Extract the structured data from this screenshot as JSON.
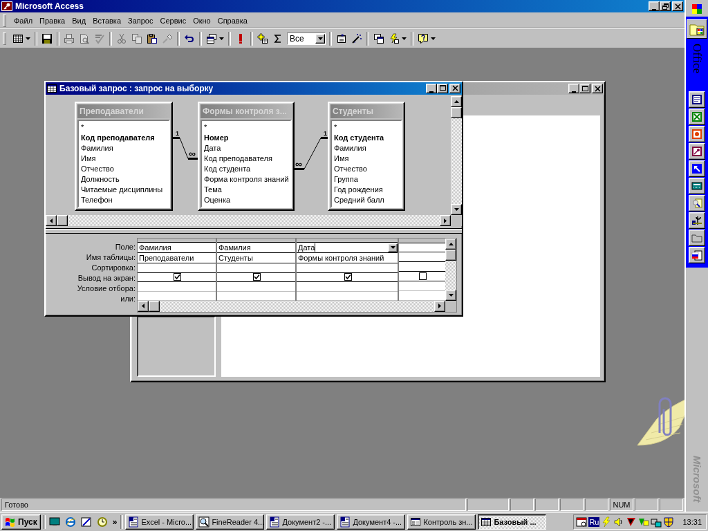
{
  "app": {
    "title": "Microsoft Access"
  },
  "menu": [
    "Файл",
    "Правка",
    "Вид",
    "Вставка",
    "Запрос",
    "Сервис",
    "Окно",
    "Справка"
  ],
  "toolbar": {
    "buttons": [
      {
        "disabled": false
      },
      {
        "disabled": false
      },
      {
        "disabled": true
      },
      {
        "disabled": true
      },
      {
        "disabled": true
      },
      {
        "disabled": true
      },
      {
        "disabled": true
      },
      {
        "disabled": false
      },
      {
        "disabled": true
      },
      {
        "disabled": false
      },
      {
        "disabled": false
      },
      {
        "disabled": false
      },
      {
        "disabled": false
      },
      {
        "disabled": false
      },
      {
        "disabled": false
      },
      {
        "disabled": false
      },
      {
        "disabled": false
      },
      {
        "disabled": false
      },
      {
        "disabled": false
      }
    ],
    "filter_combo": {
      "value": "Все"
    }
  },
  "query_window": {
    "title": "Базовый запрос : запрос на выборку",
    "tables": [
      {
        "title": "Преподаватели",
        "fields": [
          {
            "name": "*",
            "key": false
          },
          {
            "name": "Код преподавателя",
            "key": true
          },
          {
            "name": "Фамилия",
            "key": false
          },
          {
            "name": "Имя",
            "key": false
          },
          {
            "name": "Отчество",
            "key": false
          },
          {
            "name": "Должность",
            "key": false
          },
          {
            "name": "Читаемые дисциплины",
            "key": false
          },
          {
            "name": "Телефон",
            "key": false
          }
        ]
      },
      {
        "title": "Формы контроля з...",
        "fields": [
          {
            "name": "*",
            "key": false
          },
          {
            "name": "Номер",
            "key": true
          },
          {
            "name": "Дата",
            "key": false
          },
          {
            "name": "Код преподавателя",
            "key": false
          },
          {
            "name": "Код студента",
            "key": false
          },
          {
            "name": "Форма контроля знаний",
            "key": false
          },
          {
            "name": "Тема",
            "key": false
          },
          {
            "name": "Оценка",
            "key": false
          }
        ]
      },
      {
        "title": "Студенты",
        "fields": [
          {
            "name": "*",
            "key": false
          },
          {
            "name": "Код студента",
            "key": true
          },
          {
            "name": "Фамилия",
            "key": false
          },
          {
            "name": "Имя",
            "key": false
          },
          {
            "name": "Отчество",
            "key": false
          },
          {
            "name": "Группа",
            "key": false
          },
          {
            "name": "Год рождения",
            "key": false
          },
          {
            "name": "Средний балл",
            "key": false
          }
        ]
      }
    ],
    "relationships": [
      {
        "one_label": "1",
        "many_label": "∞"
      },
      {
        "one_label": "1",
        "many_label": "∞"
      }
    ],
    "grid": {
      "row_labels": [
        "Поле:",
        "Имя таблицы:",
        "Сортировка:",
        "Вывод на экран:",
        "Условие отбора:",
        "или:"
      ],
      "columns": [
        {
          "field": "Фамилия",
          "table": "Преподаватели",
          "show": true,
          "active": false
        },
        {
          "field": "Фамилия",
          "table": "Студенты",
          "show": true,
          "active": false
        },
        {
          "field": "Дата",
          "table": "Формы контроля знаний",
          "show": true,
          "active": true
        },
        {
          "show": false,
          "active": false
        }
      ]
    }
  },
  "status_bar": {
    "text": "Готово",
    "num_lock": "NUM"
  },
  "office_bar": {
    "title": "Office",
    "brand": "Microsoft"
  },
  "taskbar": {
    "start": "Пуск",
    "overflow": "»",
    "tasks": [
      {
        "kind": "document",
        "label": "Excel - Micro...",
        "selected": false
      },
      {
        "kind": "scanner",
        "label": "FineReader 4...",
        "selected": false
      },
      {
        "kind": "document",
        "label": "Документ2 -...",
        "selected": false
      },
      {
        "kind": "document",
        "label": "Документ4 -...",
        "selected": false
      },
      {
        "kind": "form",
        "label": "Контроль зн...",
        "selected": false
      },
      {
        "kind": "query",
        "label": "Базовый ...",
        "selected": true
      }
    ],
    "language": "Ru",
    "clock": "13:31"
  }
}
